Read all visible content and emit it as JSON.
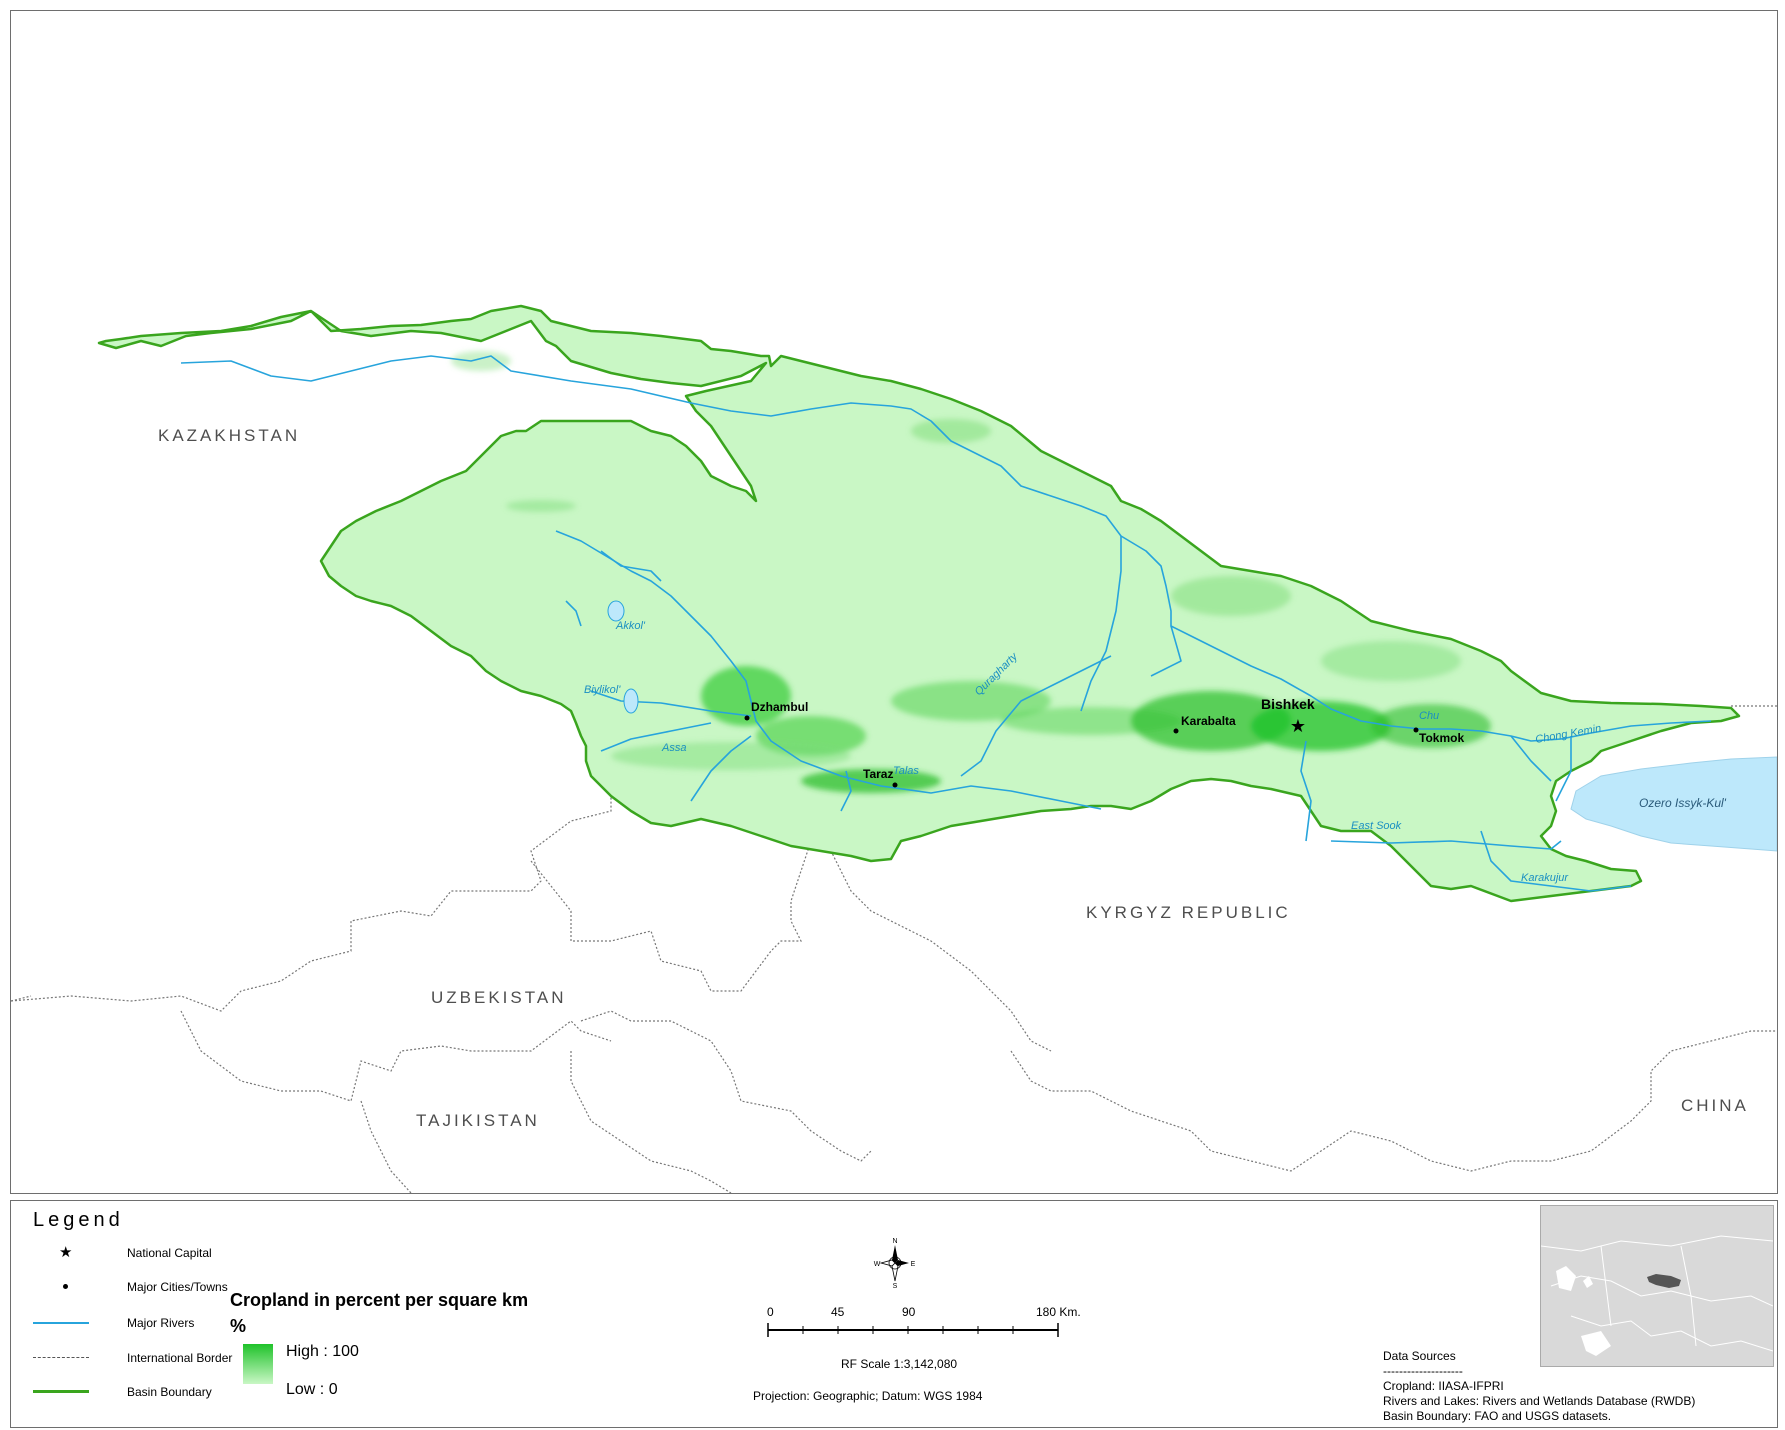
{
  "map": {
    "countries": [
      {
        "name": "KAZAKHSTAN"
      },
      {
        "name": "KYRGYZ REPUBLIC"
      },
      {
        "name": "UZBEKISTAN"
      },
      {
        "name": "TAJIKISTAN"
      },
      {
        "name": "CHINA"
      }
    ],
    "cities": {
      "capital": "Bishkek",
      "towns": [
        "Dzhambul",
        "Taraz",
        "Karabalta",
        "Tokmok"
      ]
    },
    "rivers": [
      "Akkol'",
      "Biylikol'",
      "Assa",
      "Talas",
      "Quragharty",
      "Chu",
      "Chong Kemin",
      "East Sook",
      "Karakujur"
    ],
    "lake": "Ozero Issyk-Kul'",
    "colors": {
      "basin_fill": "#c9f7c5",
      "basin_boundary": "#3aa51e",
      "cropland_high": "#1fc22a",
      "river": "#27a4dc",
      "lake": "#bde8fb",
      "border": "#777777"
    }
  },
  "legend": {
    "title": "Legend",
    "items": {
      "national_capital": "National Capital",
      "major_cities": "Major Cities/Towns",
      "major_rivers": "Major Rivers",
      "international_border": "International Border",
      "basin_boundary": "Basin Boundary"
    },
    "cropland": {
      "title": "Cropland in percent per square km",
      "unit": "%",
      "high": "High : 100",
      "low": "Low : 0",
      "high_value": 100,
      "low_value": 0
    }
  },
  "compass": {
    "n": "N",
    "s": "S",
    "e": "E",
    "w": "W"
  },
  "scale": {
    "ticks": [
      "0",
      "45",
      "90",
      "180 Km."
    ],
    "rf": "RF Scale 1:3,142,080",
    "projection": "Projection: Geographic; Datum: WGS 1984"
  },
  "sources": {
    "title": "Data Sources",
    "divider": "--------------------",
    "lines": [
      "Cropland: IIASA-IFPRI",
      "Rivers and Lakes: Rivers and Wetlands Database (RWDB)",
      "Basin Boundary: FAO and USGS datasets."
    ]
  }
}
